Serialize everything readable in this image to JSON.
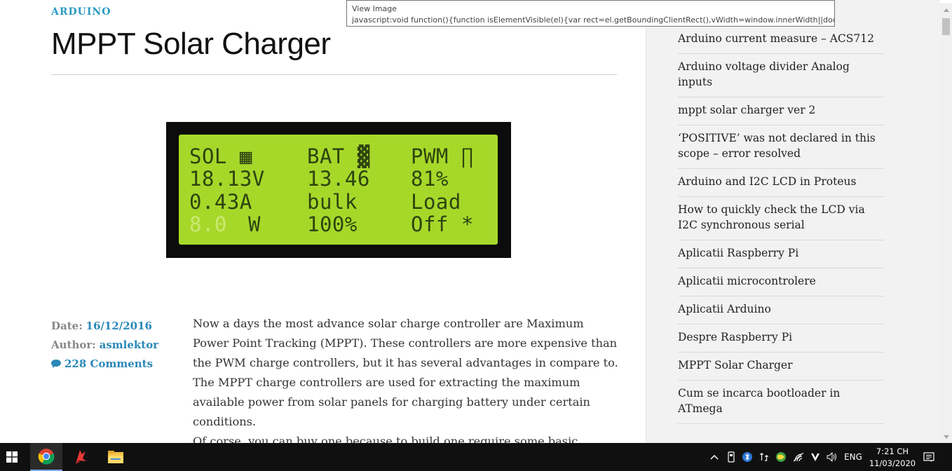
{
  "tooltip": {
    "title": "View Image",
    "url": "javascript:void function(){function isElementVisible(el){var rect=el.getBoundingClientRect(),vWidth=window.innerWidth||doc.doc..."
  },
  "post": {
    "category": "ARDUINO",
    "title": "MPPT Solar Charger",
    "lcd": {
      "rows": [
        [
          "SOL ▦",
          "BAT ▓",
          "PWM ∏"
        ],
        [
          "18.13V",
          "13.46",
          "81%"
        ],
        [
          "0.43A",
          "bulk",
          "Load"
        ],
        [
          "8.0",
          "W",
          "100%",
          "Off *"
        ]
      ]
    },
    "meta": {
      "date_label": "Date:",
      "date": "16/12/2016",
      "author_label": "Author:",
      "author": "asmlektor",
      "comments": "228 Comments"
    },
    "paragraphs": [
      "Now a days the most advance solar charge controller are Maximum Power Point Tracking (MPPT). These controllers are more expensive than the PWM charge controllers, but it has several advantages in compare to. The MPPT charge controllers are used for extracting the maximum available power from solar panels for charging battery under certain conditions.",
      "Of corse, you can buy one because to build one require some basic knowledge of electronics."
    ]
  },
  "sidebar": {
    "items": [
      "Arduino current measure – ACS712",
      "Arduino voltage divider Analog inputs",
      "mppt solar charger ver 2",
      "‘POSITIVE’ was not declared in this scope – error resolved",
      "Arduino and I2C LCD in Proteus",
      "How to quickly check the LCD via I2C synchronous serial",
      "Aplicatii Raspberry Pi",
      "Aplicatii microcontrolere",
      "Aplicatii Arduino",
      "Despre Raspberry Pi",
      "MPPT Solar Charger",
      "Cum se incarca bootloader in ATmega"
    ]
  },
  "taskbar": {
    "apps": [
      "start-icon",
      "chrome-icon",
      "app-red-icon",
      "file-explorer-icon"
    ],
    "language": "ENG",
    "time": "7:21 CH",
    "date": "11/03/2020"
  },
  "colors": {
    "accent": "#2b9bc2",
    "lcd_background": "#a6d82a",
    "lcd_text": "#2e4410",
    "taskbar": "#101010"
  }
}
